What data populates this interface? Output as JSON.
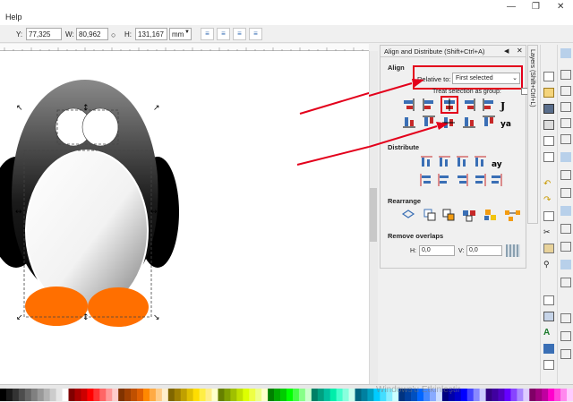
{
  "menu": {
    "help": "Help"
  },
  "toolbar": {
    "y_label": "Y:",
    "y_value": "77,325",
    "w_label": "W:",
    "w_value": "80,962",
    "h_label": "H:",
    "h_value": "131,167",
    "unit": "mm",
    "lock_icon": "lock-icon"
  },
  "panel": {
    "title": "Align and Distribute (Shift+Ctrl+A)",
    "align_heading": "Align",
    "relative_label": "Relative to:",
    "relative_value": "First selected",
    "treat_selection": "Treat selection as group:",
    "distribute_heading": "Distribute",
    "rearrange_heading": "Rearrange",
    "overlaps_heading": "Remove overlaps",
    "h_label": "H:",
    "h_value": "0,0",
    "v_label": "V:",
    "v_value": "0,0"
  },
  "layers_tab": "Layers (Shift+Ctrl+L)",
  "watermark": "Windows'u Etkinleştir",
  "colors": {
    "highlight": "#e3001b",
    "accent": "#3a6fb5",
    "penguin_feet": "#ff6f00"
  }
}
